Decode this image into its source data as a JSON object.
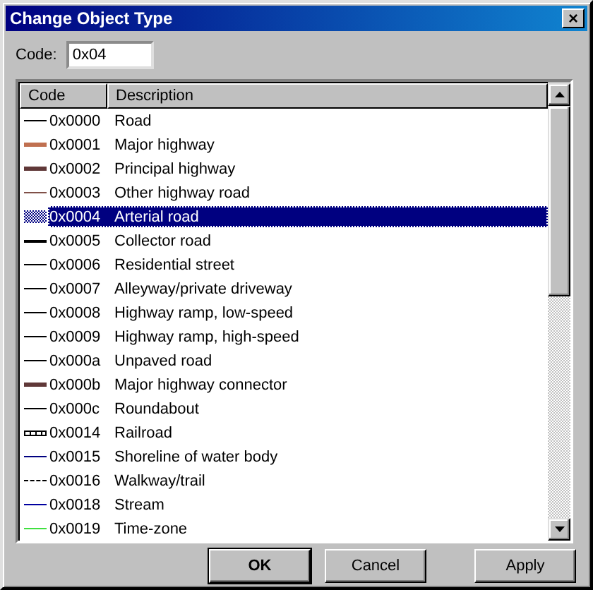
{
  "window": {
    "title": "Change Object Type",
    "close": "×"
  },
  "code_field": {
    "label": "Code:",
    "value": "0x04"
  },
  "table": {
    "columns": [
      "Code",
      "Description"
    ],
    "rows": [
      {
        "code": "0x0000",
        "description": "Road",
        "kind": "thin",
        "color": "#000000",
        "selected": false
      },
      {
        "code": "0x0001",
        "description": "Major highway",
        "kind": "thick",
        "color": "#c07050",
        "selected": false
      },
      {
        "code": "0x0002",
        "description": "Principal highway",
        "kind": "thick",
        "color": "#603838",
        "selected": false
      },
      {
        "code": "0x0003",
        "description": "Other highway road",
        "kind": "thin",
        "color": "#805048",
        "selected": false
      },
      {
        "code": "0x0004",
        "description": "Arterial road",
        "kind": "hatched",
        "color": "#000080",
        "selected": true
      },
      {
        "code": "0x0005",
        "description": "Collector road",
        "kind": "medium",
        "color": "#000000",
        "selected": false
      },
      {
        "code": "0x0006",
        "description": "Residential street",
        "kind": "thin",
        "color": "#000000",
        "selected": false
      },
      {
        "code": "0x0007",
        "description": "Alleyway/private driveway",
        "kind": "thin",
        "color": "#000000",
        "selected": false
      },
      {
        "code": "0x0008",
        "description": "Highway ramp, low-speed",
        "kind": "thin",
        "color": "#000000",
        "selected": false
      },
      {
        "code": "0x0009",
        "description": "Highway ramp, high-speed",
        "kind": "thin",
        "color": "#000000",
        "selected": false
      },
      {
        "code": "0x000a",
        "description": "Unpaved road",
        "kind": "thin",
        "color": "#000000",
        "selected": false
      },
      {
        "code": "0x000b",
        "description": "Major highway connector",
        "kind": "thick",
        "color": "#603838",
        "selected": false
      },
      {
        "code": "0x000c",
        "description": "Roundabout",
        "kind": "thin",
        "color": "#000000",
        "selected": false
      },
      {
        "code": "0x0014",
        "description": "Railroad",
        "kind": "railroad",
        "color": "#000000",
        "selected": false
      },
      {
        "code": "0x0015",
        "description": "Shoreline of water body",
        "kind": "thin",
        "color": "#000080",
        "selected": false
      },
      {
        "code": "0x0016",
        "description": "Walkway/trail",
        "kind": "dashed",
        "color": "#000000",
        "selected": false
      },
      {
        "code": "0x0018",
        "description": "Stream",
        "kind": "thin",
        "color": "#0000a0",
        "selected": false
      },
      {
        "code": "0x0019",
        "description": "Time-zone",
        "kind": "thin",
        "color": "#40e040",
        "selected": false
      }
    ]
  },
  "buttons": [
    {
      "label": "**OK**",
      "default": true
    },
    {
      "label": "Cancel",
      "default": false
    },
    {
      "label": "Apply",
      "default": false
    }
  ]
}
